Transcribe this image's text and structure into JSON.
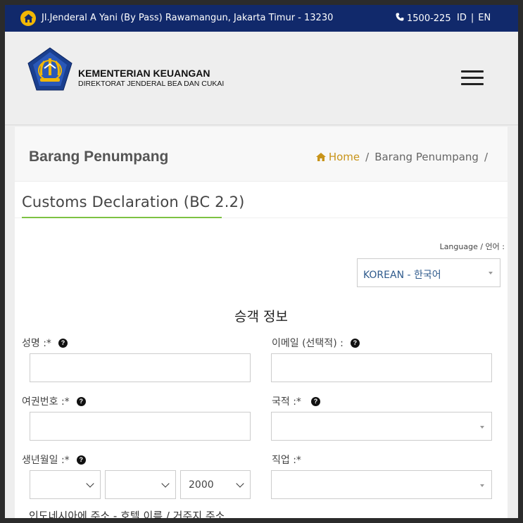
{
  "topbar": {
    "address": "Jl.Jenderal A Yani (By Pass) Rawamangun, Jakarta Timur - 13230",
    "phone": "1500-225",
    "lang_id": "ID",
    "lang_en": "EN"
  },
  "header": {
    "org_name": "KEMENTERIAN KEUANGAN",
    "org_sub": "DIREKTORAT JENDERAL BEA DAN CUKAI"
  },
  "page": {
    "title": "Barang Penumpang",
    "breadcrumb": {
      "home": "Home",
      "current": "Barang Penumpang",
      "sep": "/"
    }
  },
  "section": {
    "title": "Customs Declaration (BC 2.2)"
  },
  "language": {
    "label": "Language / 언어 :",
    "selected": "KOREAN - 한국어"
  },
  "form": {
    "heading": "승객 정보",
    "name_label": "성명 :*",
    "email_label": "이메일 (선택적) :",
    "passport_label": "여권번호 :*",
    "nationality_label": "국적 :*",
    "dob_label": "생년월일 :*",
    "dob_year": "2000",
    "occupation_label": "직업 :*",
    "address_label": "인도네시아에 주소 - 호텔 이름 / 거주지 주소"
  },
  "colors": {
    "topbar": "#11296b",
    "accent_green": "#7dc242",
    "home_gold": "#c8941a"
  }
}
